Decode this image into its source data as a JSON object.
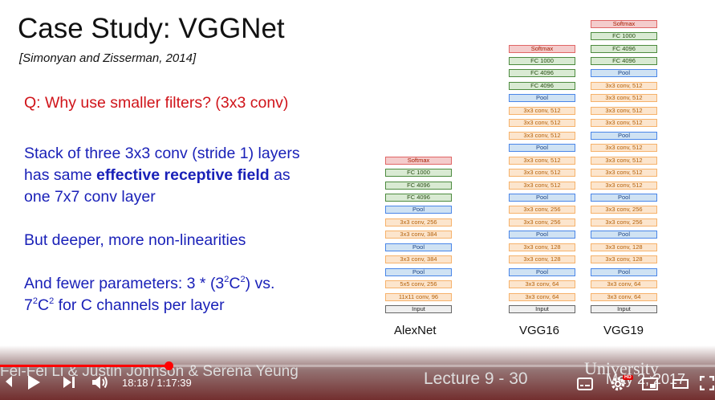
{
  "slide": {
    "title": "Case Study: VGGNet",
    "citation": "[Simonyan and Zisserman, 2014]",
    "question": "Q: Why use smaller filters? (3x3 conv)",
    "para1": {
      "line1": "Stack of three 3x3 conv (stride 1) layers",
      "line2_pre": "has same ",
      "line2_bold": "effective receptive field",
      "line2_post": " as",
      "line3": "one 7x7 conv layer"
    },
    "para2": "But deeper, more non-linearities",
    "para3": {
      "line1_pre": "And fewer parameters: 3 * (3",
      "sup_a": "2",
      "line1_mid": "C",
      "sup_b": "2",
      "line1_post": ") vs.",
      "line2_a": "7",
      "sup_c": "2",
      "line2_b": "C",
      "sup_d": "2",
      "line2_post": " for C channels per layer"
    },
    "networks": [
      {
        "label": "AlexNet",
        "layers": [
          {
            "label": "Softmax",
            "kind": "softmax"
          },
          {
            "label": "FC 1000",
            "kind": "fc"
          },
          {
            "label": "FC 4096",
            "kind": "fc"
          },
          {
            "label": "FC 4096",
            "kind": "fc"
          },
          {
            "label": "Pool",
            "kind": "pool"
          },
          {
            "label": "3x3 conv, 256",
            "kind": "conv"
          },
          {
            "label": "3x3 conv, 384",
            "kind": "conv"
          },
          {
            "label": "Pool",
            "kind": "pool"
          },
          {
            "label": "3x3 conv, 384",
            "kind": "conv"
          },
          {
            "label": "Pool",
            "kind": "pool"
          },
          {
            "label": "5x5 conv, 256",
            "kind": "conv"
          },
          {
            "label": "11x11 conv, 96",
            "kind": "conv"
          },
          {
            "label": "Input",
            "kind": "input"
          }
        ]
      },
      {
        "label": "VGG16",
        "layers": [
          {
            "label": "Softmax",
            "kind": "softmax"
          },
          {
            "label": "FC 1000",
            "kind": "fc"
          },
          {
            "label": "FC 4096",
            "kind": "fc"
          },
          {
            "label": "FC 4096",
            "kind": "fc"
          },
          {
            "label": "Pool",
            "kind": "pool"
          },
          {
            "label": "3x3 conv, 512",
            "kind": "conv"
          },
          {
            "label": "3x3 conv, 512",
            "kind": "conv"
          },
          {
            "label": "3x3 conv, 512",
            "kind": "conv"
          },
          {
            "label": "Pool",
            "kind": "pool"
          },
          {
            "label": "3x3 conv, 512",
            "kind": "conv"
          },
          {
            "label": "3x3 conv, 512",
            "kind": "conv"
          },
          {
            "label": "3x3 conv, 512",
            "kind": "conv"
          },
          {
            "label": "Pool",
            "kind": "pool"
          },
          {
            "label": "3x3 conv, 256",
            "kind": "conv"
          },
          {
            "label": "3x3 conv, 256",
            "kind": "conv"
          },
          {
            "label": "Pool",
            "kind": "pool"
          },
          {
            "label": "3x3 conv, 128",
            "kind": "conv"
          },
          {
            "label": "3x3 conv, 128",
            "kind": "conv"
          },
          {
            "label": "Pool",
            "kind": "pool"
          },
          {
            "label": "3x3 conv, 64",
            "kind": "conv"
          },
          {
            "label": "3x3 conv, 64",
            "kind": "conv"
          },
          {
            "label": "Input",
            "kind": "input"
          }
        ]
      },
      {
        "label": "VGG19",
        "layers": [
          {
            "label": "Softmax",
            "kind": "softmax"
          },
          {
            "label": "FC 1000",
            "kind": "fc"
          },
          {
            "label": "FC 4096",
            "kind": "fc"
          },
          {
            "label": "FC 4096",
            "kind": "fc"
          },
          {
            "label": "Pool",
            "kind": "pool"
          },
          {
            "label": "3x3 conv, 512",
            "kind": "conv"
          },
          {
            "label": "3x3 conv, 512",
            "kind": "conv"
          },
          {
            "label": "3x3 conv, 512",
            "kind": "conv"
          },
          {
            "label": "3x3 conv, 512",
            "kind": "conv"
          },
          {
            "label": "Pool",
            "kind": "pool"
          },
          {
            "label": "3x3 conv, 512",
            "kind": "conv"
          },
          {
            "label": "3x3 conv, 512",
            "kind": "conv"
          },
          {
            "label": "3x3 conv, 512",
            "kind": "conv"
          },
          {
            "label": "3x3 conv, 512",
            "kind": "conv"
          },
          {
            "label": "Pool",
            "kind": "pool"
          },
          {
            "label": "3x3 conv, 256",
            "kind": "conv"
          },
          {
            "label": "3x3 conv, 256",
            "kind": "conv"
          },
          {
            "label": "Pool",
            "kind": "pool"
          },
          {
            "label": "3x3 conv, 128",
            "kind": "conv"
          },
          {
            "label": "3x3 conv, 128",
            "kind": "conv"
          },
          {
            "label": "Pool",
            "kind": "pool"
          },
          {
            "label": "3x3 conv, 64",
            "kind": "conv"
          },
          {
            "label": "3x3 conv, 64",
            "kind": "conv"
          },
          {
            "label": "Input",
            "kind": "input"
          }
        ]
      }
    ],
    "footer_authors": "Fei-Fei Li & Justin Johnson & Serena Yeung",
    "footer_lecture": "Lecture 9 - 30",
    "footer_university": "University",
    "footer_date": "May 2, 2017"
  },
  "player": {
    "current_time": "18:18",
    "total_time": "1:17:39",
    "time_separator": " / ",
    "progress": 0.2357,
    "hd_badge": "HD",
    "colors": {
      "progress": "#ff0000",
      "hd": "#e00000"
    },
    "icons": [
      "play-icon",
      "next-icon",
      "volume-icon",
      "subtitles-icon",
      "settings-icon",
      "miniplayer-icon",
      "theater-icon",
      "fullscreen-icon"
    ]
  },
  "colors": {
    "question": "#d0141a",
    "body": "#1a21b8",
    "softmax": "#e06666",
    "fc": "#4d8b3f",
    "pool": "#4a86e8",
    "conv": "#f6b26b",
    "input": "#666666"
  }
}
